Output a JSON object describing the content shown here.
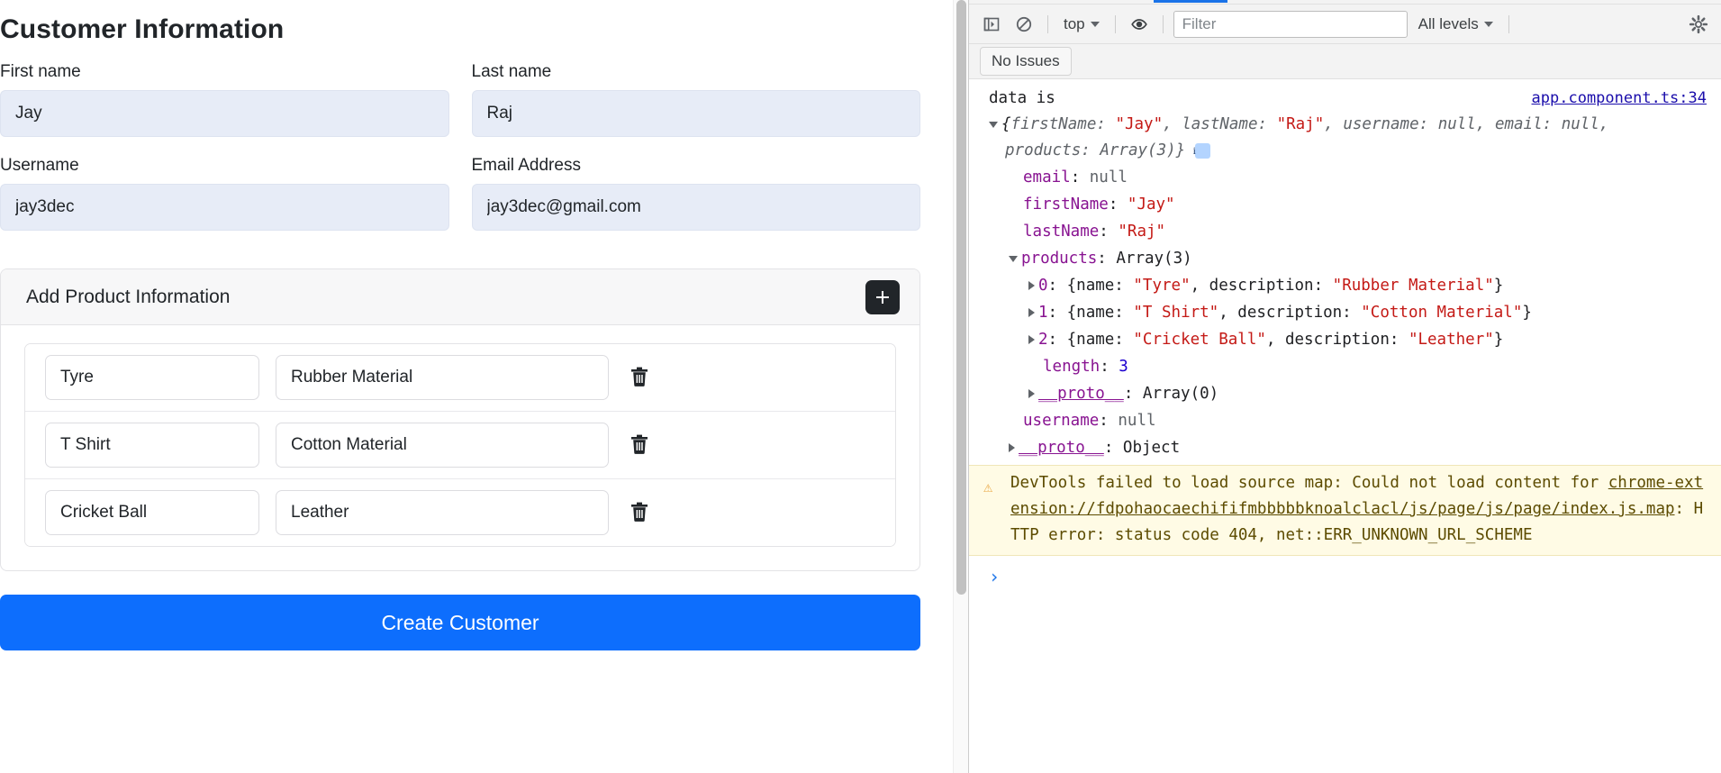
{
  "form": {
    "title": "Customer Information",
    "fields": [
      {
        "label": "First name",
        "value": "Jay"
      },
      {
        "label": "Last name",
        "value": "Raj"
      },
      {
        "label": "Username",
        "value": "jay3dec"
      },
      {
        "label": "Email Address",
        "value": "jay3dec@gmail.com"
      }
    ],
    "product_section": {
      "title": "Add Product Information",
      "add_button_label": "+",
      "rows": [
        {
          "name": "Tyre",
          "description": "Rubber Material"
        },
        {
          "name": "T Shirt",
          "description": "Cotton Material"
        },
        {
          "name": "Cricket Ball",
          "description": "Leather"
        }
      ]
    },
    "submit_label": "Create Customer",
    "colors": {
      "accent": "#0d6efd",
      "filled_input_bg": "#e7ecf7",
      "add_button_bg": "#212529"
    }
  },
  "devtools": {
    "toolbar": {
      "context_label": "top",
      "levels_label": "All levels",
      "filter_placeholder": "Filter",
      "filter_value": ""
    },
    "issues_label": "No Issues",
    "console": {
      "message_label": "data is",
      "source_link": "app.component.ts:34",
      "preview": {
        "open_brace": "{",
        "k_firstName": "firstName: ",
        "v_firstName": "\"Jay\"",
        "sep1": ", ",
        "k_lastName": "lastName: ",
        "v_lastName": "\"Raj\"",
        "sep2": ", ",
        "k_username": "username: ",
        "v_username": "null",
        "sep3": ", ",
        "k_email": "email: ",
        "v_email": "null",
        "sep4": ", ",
        "k_products": "products: ",
        "v_products": "Array(3)",
        "close_brace": "}",
        "badge": "i"
      },
      "props": [
        {
          "key": "email",
          "sep": ": ",
          "value": "null",
          "kind": "null"
        },
        {
          "key": "firstName",
          "sep": ": ",
          "value": "\"Jay\"",
          "kind": "string"
        },
        {
          "key": "lastName",
          "sep": ": ",
          "value": "\"Raj\"",
          "kind": "string"
        }
      ],
      "products_key": "products",
      "products_value": "Array(3)",
      "array_items": [
        {
          "index": "0",
          "text": "{name: ",
          "name": "\"Tyre\"",
          "mid": ", description: ",
          "desc": "\"Rubber Material\"",
          "end": "}"
        },
        {
          "index": "1",
          "text": "{name: ",
          "name": "\"T Shirt\"",
          "mid": ", description: ",
          "desc": "\"Cotton Material\"",
          "end": "}"
        },
        {
          "index": "2",
          "text": "{name: ",
          "name": "\"Cricket Ball\"",
          "mid": ", description: ",
          "desc": "\"Leather\"",
          "end": "}"
        }
      ],
      "length_key": "length",
      "length_value": "3",
      "array_proto_key": "__proto__",
      "array_proto_value": "Array(0)",
      "username_key": "username",
      "username_value": "null",
      "object_proto_key": "__proto__",
      "object_proto_value": "Object",
      "warning": {
        "icon": "⚠",
        "text_before": "DevTools failed to load source map: Could not load content for ",
        "link": "chrome-extension://fdpohaocaechififmbbbbbknoalclacl/js/page/js/page/index.js.map",
        "text_after": ": HTTP error: status code 404, net::ERR_UNKNOWN_URL_SCHEME"
      },
      "prompt": "›"
    }
  }
}
